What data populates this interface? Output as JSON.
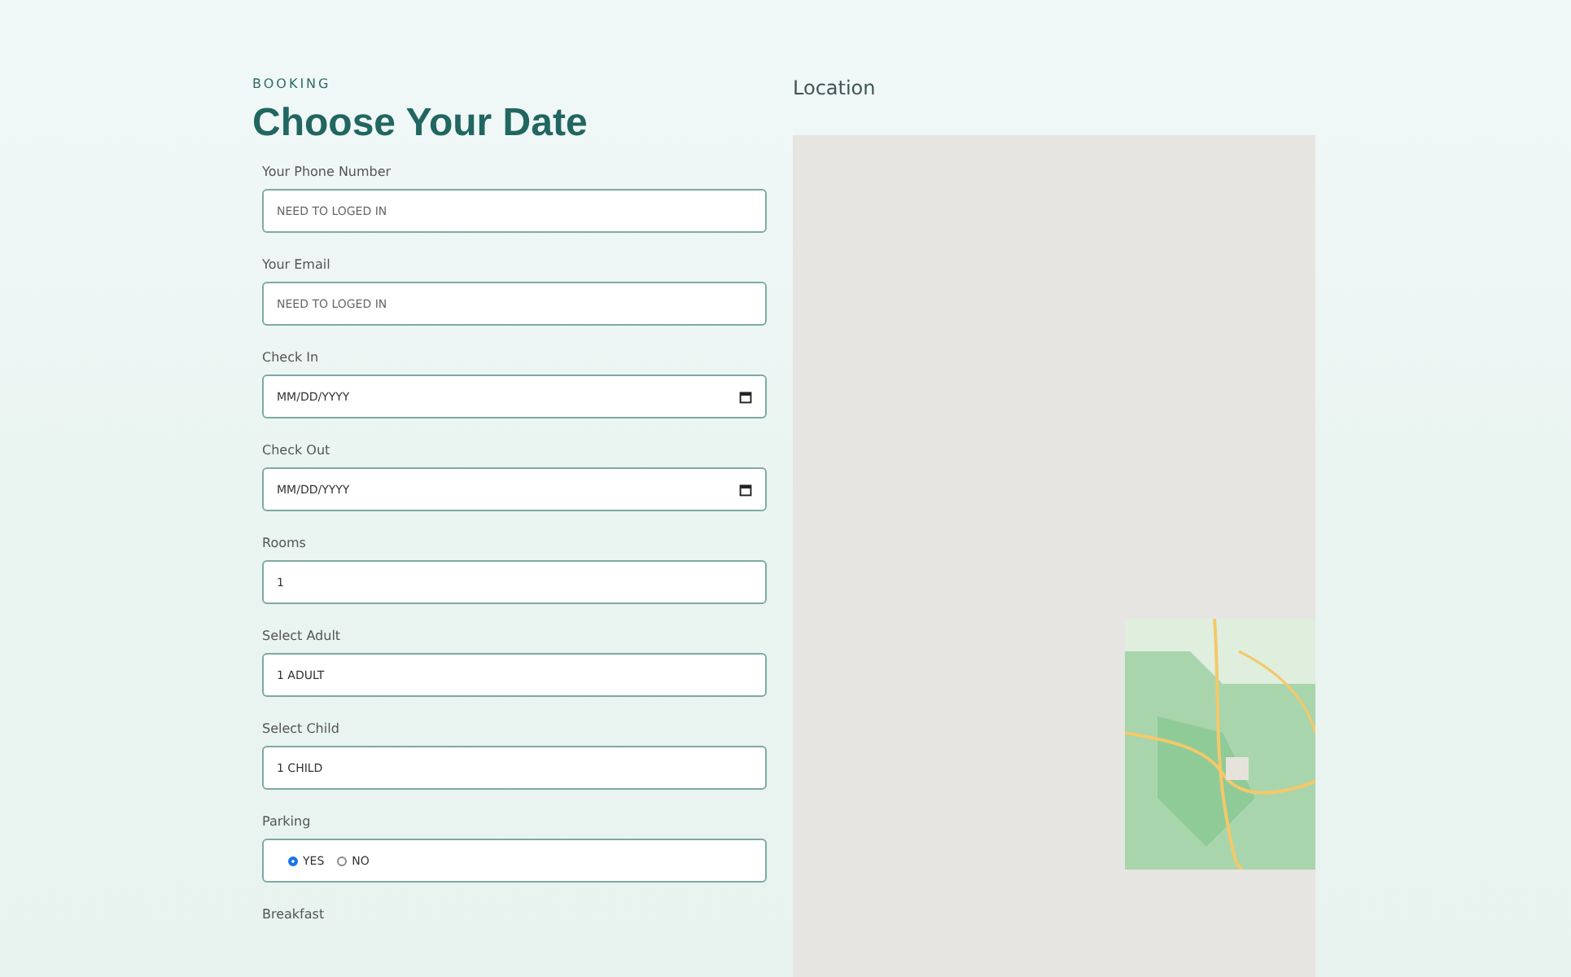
{
  "header": {
    "eyebrow": "BOOKING",
    "title": "Choose Your Date"
  },
  "fields": [
    {
      "kind": "text",
      "label": "Your Phone Number",
      "placeholder": "NEED TO LOGED IN"
    },
    {
      "kind": "text",
      "label": "Your Email",
      "placeholder": "NEED TO LOGED IN"
    },
    {
      "kind": "date",
      "label": "Check In",
      "value": "MM/DD/YYYY"
    },
    {
      "kind": "date",
      "label": "Check Out",
      "value": "MM/DD/YYYY"
    },
    {
      "kind": "value",
      "label": "Rooms",
      "value": "1"
    },
    {
      "kind": "value",
      "label": "Select Adult",
      "value": "1 ADULT"
    },
    {
      "kind": "value",
      "label": "Select Child",
      "value": "1 CHILD"
    },
    {
      "kind": "radio",
      "label": "Parking",
      "options": [
        {
          "label": "YES",
          "selected": true
        },
        {
          "label": "NO",
          "selected": false
        }
      ]
    },
    {
      "kind": "heading",
      "label": "Breakfast"
    }
  ],
  "location": {
    "title": "Location"
  }
}
